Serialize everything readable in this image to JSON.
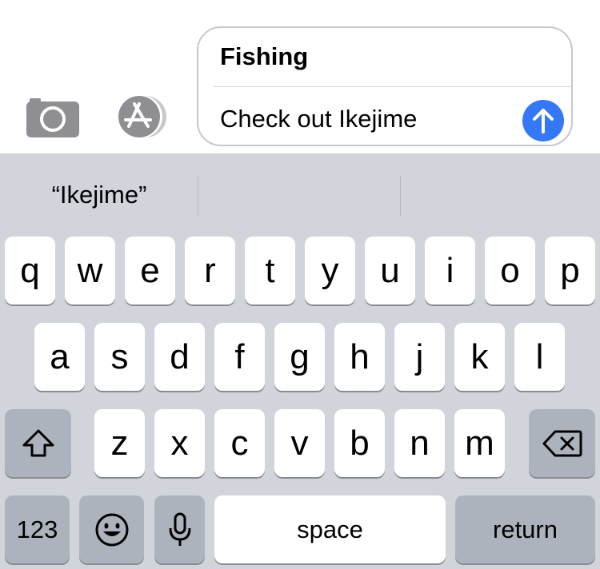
{
  "compose": {
    "subject": "Fishing",
    "message": "Check out Ikejime"
  },
  "predictions": [
    "“Ikejime”",
    "",
    ""
  ],
  "keyboard": {
    "row1": [
      "q",
      "w",
      "e",
      "r",
      "t",
      "y",
      "u",
      "i",
      "o",
      "p"
    ],
    "row2": [
      "a",
      "s",
      "d",
      "f",
      "g",
      "h",
      "j",
      "k",
      "l"
    ],
    "row3": [
      "z",
      "x",
      "c",
      "v",
      "b",
      "n",
      "m"
    ],
    "numbers_label": "123",
    "space_label": "space",
    "return_label": "return"
  },
  "colors": {
    "send_button": "#3478f6",
    "keyboard_bg": "#d1d4da",
    "dark_key": "#adb3bd"
  },
  "icons": [
    "camera-icon",
    "app-store-icon",
    "send-arrow-icon",
    "shift-icon",
    "delete-icon",
    "emoji-icon",
    "microphone-icon"
  ]
}
